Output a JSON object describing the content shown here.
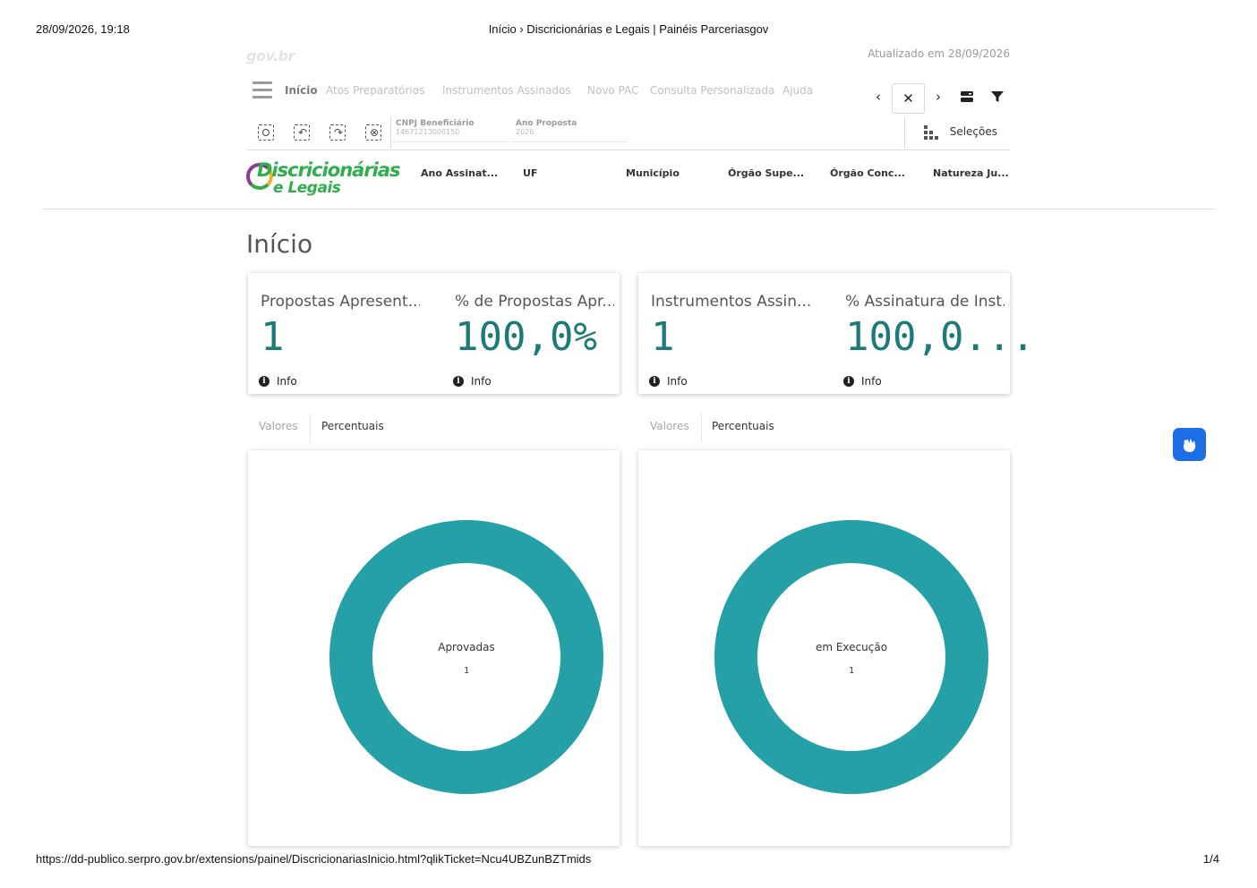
{
  "print": {
    "datetime": "28/09/2026, 19:18",
    "page_title": "Início › Discricionárias e Legais | Painéis Parceriasgov",
    "url": "https://dd-publico.serpro.gov.br/extensions/painel/DiscricionariasInicio.html?qlikTicket=Ncu4UBZunBZTmids",
    "page_number": "1/4"
  },
  "header": {
    "gov_logo": "gov.br",
    "updated": "Atualizado em 28/09/2026"
  },
  "nav": {
    "items": [
      {
        "label": "Início",
        "active": true
      },
      {
        "label": "Atos Preparatórios",
        "active": false
      },
      {
        "label": "Instrumentos Assinados",
        "active": false
      },
      {
        "label": "Novo PAC",
        "active": false
      },
      {
        "label": "Consulta Personalizada",
        "active": false
      },
      {
        "label": "Ajuda",
        "active": false
      }
    ],
    "buttons": {
      "prev": "‹",
      "clear": "✕",
      "next": "›"
    }
  },
  "toolbar": {
    "selections_label": "Seleções",
    "fields": [
      {
        "label": "CNPJ Beneficiário",
        "value": "14671213000150"
      },
      {
        "label": "Ano Proposta",
        "value": "2026"
      }
    ]
  },
  "brand": {
    "line1": "Discricionárias",
    "line2": "e Legais"
  },
  "filters": [
    "Ano Assinat...",
    "UF",
    "Município",
    "Órgão Supe...",
    "Órgão Conc...",
    "Natureza Ju..."
  ],
  "page": {
    "title": "Início"
  },
  "kpis": [
    {
      "title": "Propostas Apresent...",
      "value": "1",
      "info": "Info"
    },
    {
      "title": "% de Propostas Apr...",
      "value": "100,0%",
      "info": "Info"
    },
    {
      "title": "Instrumentos Assin...",
      "value": "1",
      "info": "Info"
    },
    {
      "title": "% Assinatura de Inst...",
      "value": "100,0...",
      "info": "Info"
    }
  ],
  "tabs": {
    "left": [
      "Valores",
      "Percentuais"
    ],
    "right": [
      "Valores",
      "Percentuais"
    ]
  },
  "chart_data": [
    {
      "type": "pie",
      "donut": true,
      "categories": [
        "Aprovadas"
      ],
      "values": [
        1
      ],
      "center_label": "Aprovadas",
      "center_value": "1",
      "color": "#26a0a7"
    },
    {
      "type": "pie",
      "donut": true,
      "categories": [
        "em Execução"
      ],
      "values": [
        1
      ],
      "center_label": "em Execução",
      "center_value": "1",
      "color": "#26a0a7"
    }
  ],
  "accessibility": {
    "vlibras_icon": "sign-language-icon"
  }
}
